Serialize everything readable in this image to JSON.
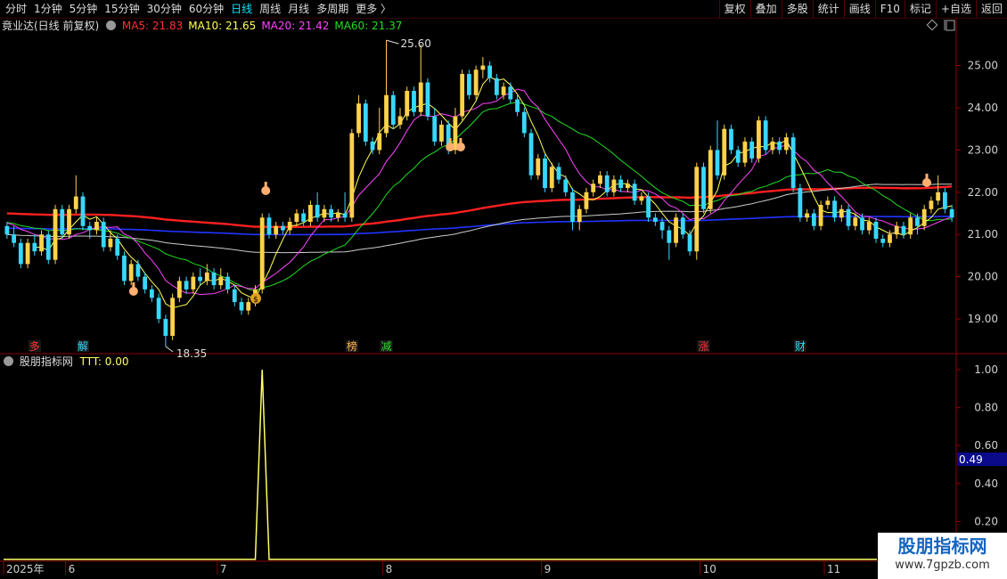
{
  "toolbar": {
    "periods": [
      "分时",
      "1分钟",
      "5分钟",
      "15分钟",
      "30分钟",
      "60分钟",
      "日线",
      "周线",
      "月线",
      "多周期",
      "更多 〉"
    ],
    "active_period": "日线",
    "tools": [
      "复权",
      "叠加",
      "多股",
      "统计",
      "画线",
      "F10",
      "标记",
      "+自选",
      "返回"
    ]
  },
  "stock_header": {
    "name": "竟业达(日线 前复权)",
    "ma": [
      {
        "label": "MA5: 21.83",
        "color": "#ff3030"
      },
      {
        "label": "MA10: 21.65",
        "color": "#ffff55"
      },
      {
        "label": "MA20: 21.42",
        "color": "#ff44ff"
      },
      {
        "label": "MA60: 21.37",
        "color": "#22dd22"
      }
    ]
  },
  "indicator_header": {
    "name": "股朋指标网",
    "value": "TTT: 0.00"
  },
  "colors": {
    "up": "#ffd24a",
    "down": "#37d8ff",
    "ma5": "#ffffff",
    "ma10": "#ffff55",
    "ma20": "#ff44ff",
    "ma60": "#22dd22",
    "ma120": "#ff2020",
    "ma250": "#2233ff",
    "ma_long": "#cccccc",
    "ttt": "#ffff66",
    "axis": "#8b0000"
  },
  "icons": [
    "hand-pointer-icon",
    "money-bag-icon"
  ],
  "chart_data": [
    {
      "type": "candlestick",
      "y_ticks": [
        "25.00",
        "24.00",
        "23.00",
        "22.00",
        "21.00",
        "20.00",
        "19.00"
      ],
      "ylim": [
        18.2,
        25.75
      ],
      "annotations": {
        "high": "25.60",
        "low": "18.35"
      },
      "month_labels": [
        {
          "label": "2025年",
          "i": 0
        },
        {
          "label": "6",
          "i": 9
        },
        {
          "label": "7",
          "i": 31
        },
        {
          "label": "8",
          "i": 55
        },
        {
          "label": "9",
          "i": 78
        },
        {
          "label": "10",
          "i": 101
        },
        {
          "label": "11",
          "i": 119
        }
      ],
      "event_markers": [
        {
          "text": "多",
          "i": 4,
          "color": "#ff3030"
        },
        {
          "text": "解",
          "i": 11,
          "color": "#37d8ff"
        },
        {
          "text": "榜",
          "i": 50,
          "color": "#ffb040"
        },
        {
          "text": "减",
          "i": 55,
          "color": "#22dd22"
        },
        {
          "text": "涨",
          "i": 101,
          "color": "#ff3030"
        },
        {
          "text": "财",
          "i": 115,
          "color": "#37d8ff"
        }
      ],
      "candles": [
        [
          21.2,
          21.0,
          21.3,
          20.9
        ],
        [
          21.0,
          20.8,
          21.2,
          20.7
        ],
        [
          20.8,
          20.3,
          20.9,
          20.2
        ],
        [
          20.3,
          20.8,
          20.9,
          20.2
        ],
        [
          20.8,
          20.6,
          21.0,
          20.5
        ],
        [
          20.6,
          21.0,
          21.1,
          20.5
        ],
        [
          21.0,
          20.4,
          21.1,
          20.3
        ],
        [
          20.4,
          21.6,
          21.7,
          20.3
        ],
        [
          21.6,
          21.0,
          21.7,
          20.9
        ],
        [
          21.0,
          21.6,
          21.7,
          20.9
        ],
        [
          21.6,
          21.9,
          22.4,
          21.5
        ],
        [
          21.9,
          21.2,
          22.0,
          21.1
        ],
        [
          21.2,
          21.1,
          21.3,
          20.9
        ],
        [
          21.1,
          21.3,
          21.4,
          21.0
        ],
        [
          21.3,
          20.7,
          21.4,
          20.6
        ],
        [
          20.7,
          20.9,
          21.1,
          20.6
        ],
        [
          20.9,
          20.5,
          21.0,
          20.4
        ],
        [
          20.5,
          19.9,
          20.6,
          19.8
        ],
        [
          19.9,
          20.3,
          20.4,
          19.8
        ],
        [
          20.3,
          20.0,
          20.4,
          19.9
        ],
        [
          20.0,
          19.7,
          20.1,
          19.6
        ],
        [
          19.7,
          19.5,
          19.8,
          19.4
        ],
        [
          19.5,
          19.0,
          19.6,
          18.9
        ],
        [
          19.0,
          18.6,
          19.1,
          18.35
        ],
        [
          18.6,
          19.5,
          19.6,
          18.5
        ],
        [
          19.5,
          19.9,
          20.0,
          19.4
        ],
        [
          19.9,
          19.7,
          20.0,
          19.6
        ],
        [
          19.7,
          20.0,
          20.1,
          19.6
        ],
        [
          20.0,
          19.9,
          20.2,
          19.8
        ],
        [
          19.9,
          20.1,
          20.3,
          19.8
        ],
        [
          20.1,
          19.8,
          20.2,
          19.7
        ],
        [
          19.8,
          20.0,
          20.2,
          19.7
        ],
        [
          20.0,
          19.7,
          20.1,
          19.6
        ],
        [
          19.7,
          19.4,
          19.8,
          19.3
        ],
        [
          19.4,
          19.2,
          19.5,
          19.1
        ],
        [
          19.2,
          19.4,
          19.5,
          19.1
        ],
        [
          19.4,
          19.7,
          19.8,
          19.3
        ],
        [
          19.7,
          21.4,
          21.5,
          19.6
        ],
        [
          21.4,
          21.0,
          21.5,
          20.9
        ],
        [
          21.0,
          21.2,
          21.3,
          20.9
        ],
        [
          21.2,
          21.1,
          21.3,
          21.0
        ],
        [
          21.1,
          21.3,
          21.4,
          21.0
        ],
        [
          21.3,
          21.5,
          21.6,
          21.2
        ],
        [
          21.5,
          21.3,
          21.6,
          21.2
        ],
        [
          21.3,
          21.7,
          21.8,
          21.2
        ],
        [
          21.7,
          21.4,
          22.0,
          21.3
        ],
        [
          21.4,
          21.6,
          21.7,
          21.3
        ],
        [
          21.6,
          21.4,
          21.7,
          21.3
        ],
        [
          21.4,
          21.5,
          21.6,
          21.3
        ],
        [
          21.5,
          21.4,
          22.0,
          21.3
        ],
        [
          21.4,
          23.4,
          23.5,
          21.3
        ],
        [
          23.4,
          24.1,
          24.3,
          23.3
        ],
        [
          24.1,
          23.2,
          24.2,
          23.1
        ],
        [
          23.2,
          23.0,
          23.3,
          22.9
        ],
        [
          23.0,
          23.4,
          24.0,
          22.9
        ],
        [
          23.4,
          24.3,
          25.6,
          23.3
        ],
        [
          24.3,
          23.6,
          24.4,
          23.5
        ],
        [
          23.6,
          23.8,
          24.0,
          23.5
        ],
        [
          23.8,
          24.4,
          24.5,
          23.7
        ],
        [
          24.4,
          23.9,
          24.5,
          23.8
        ],
        [
          23.9,
          24.6,
          25.5,
          23.8
        ],
        [
          24.6,
          23.8,
          24.7,
          23.7
        ],
        [
          23.8,
          23.2,
          24.0,
          23.1
        ],
        [
          23.2,
          23.6,
          23.7,
          23.1
        ],
        [
          23.6,
          23.0,
          23.7,
          22.9
        ],
        [
          23.0,
          23.8,
          24.0,
          22.9
        ],
        [
          23.8,
          24.8,
          24.9,
          23.7
        ],
        [
          24.8,
          24.3,
          24.9,
          24.2
        ],
        [
          24.3,
          24.9,
          25.0,
          24.2
        ],
        [
          24.9,
          25.0,
          25.2,
          24.7
        ],
        [
          25.0,
          24.7,
          25.1,
          24.6
        ],
        [
          24.7,
          24.3,
          24.8,
          24.2
        ],
        [
          24.3,
          24.5,
          24.6,
          24.2
        ],
        [
          24.5,
          24.2,
          24.6,
          24.1
        ],
        [
          24.2,
          23.9,
          24.3,
          23.8
        ],
        [
          23.9,
          23.4,
          24.0,
          23.3
        ],
        [
          23.4,
          22.4,
          23.5,
          22.3
        ],
        [
          22.4,
          22.8,
          22.9,
          22.3
        ],
        [
          22.8,
          22.1,
          22.9,
          22.0
        ],
        [
          22.1,
          22.6,
          22.7,
          22.0
        ],
        [
          22.6,
          22.3,
          22.7,
          22.2
        ],
        [
          22.3,
          22.0,
          22.4,
          21.9
        ],
        [
          22.0,
          21.3,
          22.1,
          21.1
        ],
        [
          21.3,
          21.6,
          21.7,
          21.1
        ],
        [
          21.6,
          22.0,
          22.1,
          21.5
        ],
        [
          22.0,
          22.2,
          22.3,
          21.9
        ],
        [
          22.2,
          22.4,
          22.5,
          22.1
        ],
        [
          22.4,
          22.0,
          22.5,
          21.9
        ],
        [
          22.0,
          22.3,
          22.4,
          21.9
        ],
        [
          22.3,
          22.1,
          22.4,
          22.0
        ],
        [
          22.1,
          22.2,
          22.3,
          22.0
        ],
        [
          22.2,
          21.8,
          22.3,
          21.7
        ],
        [
          21.8,
          21.9,
          22.0,
          21.7
        ],
        [
          21.9,
          21.4,
          22.0,
          21.3
        ],
        [
          21.4,
          21.3,
          21.5,
          21.2
        ],
        [
          21.3,
          21.1,
          21.4,
          20.9
        ],
        [
          21.1,
          20.8,
          21.2,
          20.4
        ],
        [
          20.8,
          21.4,
          21.5,
          20.7
        ],
        [
          21.4,
          21.0,
          21.5,
          20.9
        ],
        [
          21.0,
          20.6,
          21.1,
          20.5
        ],
        [
          20.6,
          22.6,
          22.7,
          20.4
        ],
        [
          22.6,
          21.6,
          22.7,
          21.5
        ],
        [
          21.6,
          23.0,
          23.1,
          21.5
        ],
        [
          23.0,
          22.4,
          23.7,
          22.3
        ],
        [
          22.4,
          23.5,
          23.6,
          22.3
        ],
        [
          23.5,
          23.0,
          23.6,
          22.9
        ],
        [
          23.0,
          22.7,
          23.1,
          22.6
        ],
        [
          22.7,
          23.2,
          23.3,
          22.6
        ],
        [
          23.2,
          22.8,
          23.3,
          22.7
        ],
        [
          22.8,
          23.7,
          23.8,
          22.7
        ],
        [
          23.7,
          23.0,
          23.8,
          22.9
        ],
        [
          23.0,
          23.2,
          23.3,
          22.9
        ],
        [
          23.2,
          23.0,
          23.3,
          22.9
        ],
        [
          23.0,
          23.3,
          23.4,
          22.9
        ],
        [
          23.3,
          22.1,
          23.4,
          22.0
        ],
        [
          22.1,
          21.4,
          22.2,
          21.3
        ],
        [
          21.4,
          21.5,
          21.6,
          21.3
        ],
        [
          21.5,
          21.2,
          21.6,
          21.1
        ],
        [
          21.2,
          21.7,
          21.8,
          21.1
        ],
        [
          21.7,
          21.8,
          21.9,
          21.6
        ],
        [
          21.8,
          21.4,
          21.9,
          21.3
        ],
        [
          21.4,
          21.6,
          21.7,
          21.3
        ],
        [
          21.6,
          21.2,
          21.7,
          21.1
        ],
        [
          21.2,
          21.4,
          21.5,
          21.1
        ],
        [
          21.4,
          21.1,
          21.5,
          21.0
        ],
        [
          21.1,
          21.3,
          21.4,
          21.0
        ],
        [
          21.3,
          20.9,
          21.4,
          20.8
        ],
        [
          20.9,
          20.8,
          21.0,
          20.7
        ],
        [
          20.8,
          21.0,
          21.1,
          20.7
        ],
        [
          21.0,
          21.2,
          21.3,
          20.9
        ],
        [
          21.2,
          21.0,
          21.3,
          20.9
        ],
        [
          21.0,
          21.4,
          21.5,
          20.9
        ],
        [
          21.4,
          21.2,
          21.5,
          21.0
        ],
        [
          21.2,
          21.6,
          21.7,
          21.1
        ],
        [
          21.6,
          21.8,
          21.9,
          21.5
        ],
        [
          21.8,
          22.0,
          22.4,
          21.7
        ],
        [
          22.0,
          21.6,
          22.1,
          21.5
        ],
        [
          21.6,
          21.4,
          21.7,
          21.3
        ]
      ]
    },
    {
      "type": "line",
      "series_name": "TTT",
      "y_ticks": [
        "1.00",
        "0.80",
        "0.60",
        "0.40",
        "0.20"
      ],
      "ylim": [
        0,
        1.08
      ],
      "current_value_badge": "0.49",
      "spike": {
        "i": 37,
        "value": 1.0
      }
    }
  ]
}
